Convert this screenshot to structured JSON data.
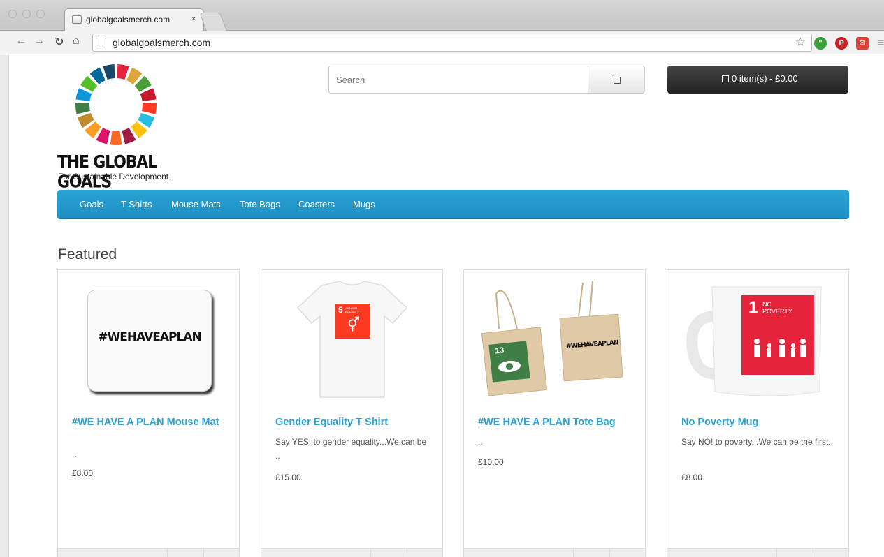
{
  "browser": {
    "tab_title": "globalgoalsmerch.com",
    "tab_close": "×",
    "url": "globalgoalsmerch.com"
  },
  "logo": {
    "title": "THE GLOBAL GOALS",
    "subtitle": "For Sustainable Development",
    "wheel_colors": [
      "#e5243b",
      "#dda63a",
      "#4c9f38",
      "#c5192d",
      "#ff3a21",
      "#26bde2",
      "#fcc30b",
      "#a21942",
      "#fd6925",
      "#dd1367",
      "#fd9d24",
      "#bf8b2e",
      "#3f7e44",
      "#0a97d9",
      "#56c02b",
      "#00689d",
      "#19486a"
    ]
  },
  "search": {
    "placeholder": "Search"
  },
  "cart": {
    "label": "0 item(s) - £0.00"
  },
  "menu": {
    "items": [
      "Goals",
      "T Shirts",
      "Mouse Mats",
      "Tote Bags",
      "Coasters",
      "Mugs"
    ]
  },
  "featured": {
    "heading": "Featured",
    "products": [
      {
        "title": "#WE HAVE A PLAN Mouse Mat",
        "desc": "..",
        "price": "£8.00",
        "image_text": "#WEHAVEAPLAN"
      },
      {
        "title": "Gender Equality T Shirt",
        "desc": "Say YES! to gender equality...We can be ..",
        "price": "£15.00",
        "image_number": "5",
        "image_caption": "GENDER EQUALITY"
      },
      {
        "title": "#WE HAVE A PLAN Tote Bag",
        "desc": "..",
        "price": "£10.00",
        "image_text": "#WEHAVEAPLAN",
        "image_number": "13",
        "image_caption": "CLIMATE ACTION"
      },
      {
        "title": "No Poverty Mug",
        "desc": "Say NO! to poverty...We can be the first..",
        "price": "£8.00",
        "image_number": "1",
        "image_caption": "NO POVERTY"
      }
    ]
  },
  "colors": {
    "menu_blue": "#2aa3d4",
    "link_blue": "#2aa3d4",
    "cart_dark": "#2a2a2a"
  }
}
